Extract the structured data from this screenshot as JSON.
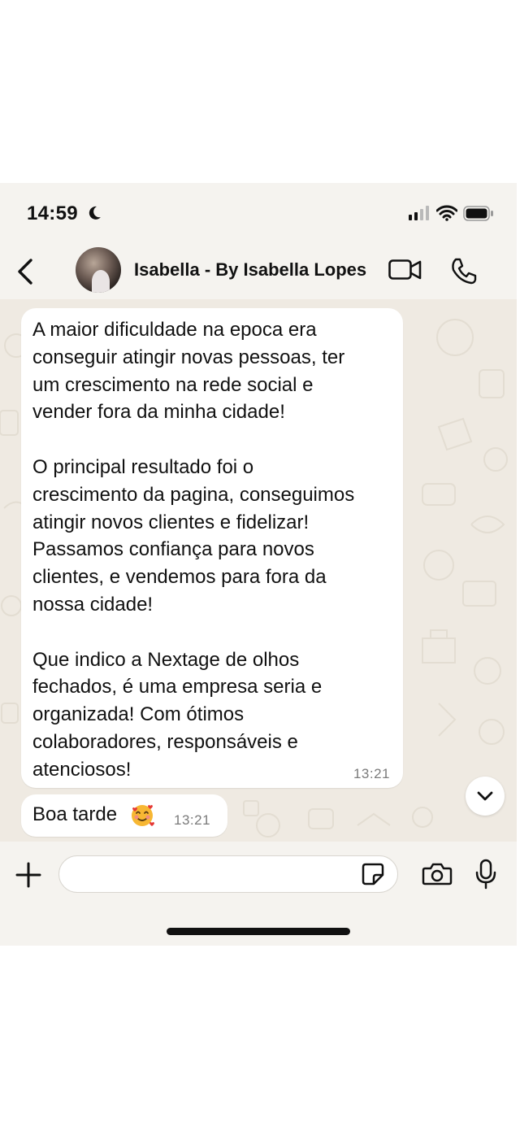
{
  "status_bar": {
    "time": "14:59"
  },
  "header": {
    "contact_name": "Isabella - By Isabella Lopes"
  },
  "messages": [
    {
      "text": "A maior dificuldade na epoca era\nconseguir atingir novas pessoas, ter\num crescimento na rede social e\nvender fora da minha cidade!\n\nO principal resultado foi o\ncrescimento da pagina, conseguimos\natingir novos clientes e fidelizar!\nPassamos confiança para novos\nclientes, e vendemos para fora da\nnossa cidade!\n\nQue indico a Nextage de olhos\nfechados, é uma empresa seria e\norganizada! Com ótimos\ncolaboradores, responsáveis e\natenciosos!",
      "time": "13:21"
    },
    {
      "text": "Boa tarde",
      "emoji": "smiling-face-with-hearts",
      "time": "13:21"
    }
  ],
  "input": {
    "placeholder": "",
    "value": ""
  },
  "icons": {
    "back": "chevron-left-icon",
    "video": "video-camera-icon",
    "call": "phone-icon",
    "add": "plus-icon",
    "sticker": "sticker-icon",
    "camera": "camera-icon",
    "mic": "microphone-icon"
  },
  "colors": {
    "chat_background": "#efeae2",
    "bubble": "#ffffff",
    "bars": "#f5f3ef"
  }
}
